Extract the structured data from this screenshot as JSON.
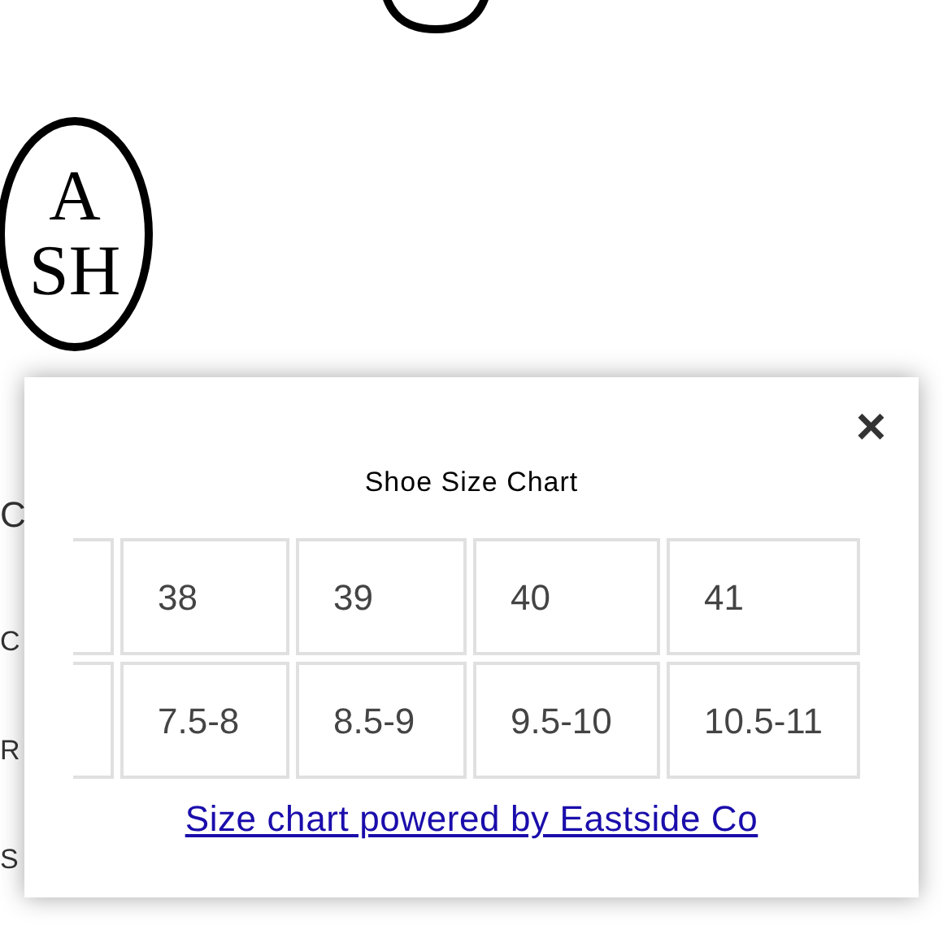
{
  "logo": {
    "top": "A",
    "bottom": "SH"
  },
  "background_text": [
    "C",
    "C",
    "R",
    "S"
  ],
  "modal": {
    "title": "Shoe Size Chart",
    "close": "×",
    "rows": [
      [
        "38",
        "39",
        "40",
        "41"
      ],
      [
        "7.5-8",
        "8.5-9",
        "9.5-10",
        "10.5-11"
      ]
    ],
    "link": "Size chart powered by Eastside Co"
  }
}
